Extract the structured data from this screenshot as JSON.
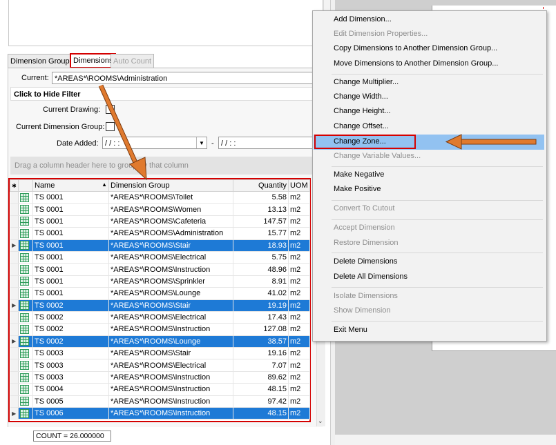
{
  "tabs": [
    {
      "label": "Dimension Groups"
    },
    {
      "label": "Dimensions"
    },
    {
      "label": "Auto Count"
    }
  ],
  "filter": {
    "current_label": "Current:",
    "current_value": "*AREAS*\\ROOMS\\Administration",
    "hide_filter_label": "Click to Hide Filter",
    "current_drawing_label": "Current Drawing:",
    "current_group_label": "Current Dimension Group:",
    "date_added_label": "Date Added:",
    "date_from": "/  /       :  :",
    "date_sep": "-",
    "date_to": "/  /       :  :"
  },
  "group_hint": "Drag a column header here to group by that column",
  "grid": {
    "columns": [
      "Name",
      "Dimension Group",
      "Quantity",
      "UOM"
    ],
    "rows": [
      {
        "name": "TS 0001",
        "group": "*AREAS*\\ROOMS\\Toilet",
        "qty": "5.58",
        "uom": "m2",
        "selected": false
      },
      {
        "name": "TS 0001",
        "group": "*AREAS*\\ROOMS\\Women",
        "qty": "13.13",
        "uom": "m2",
        "selected": false
      },
      {
        "name": "TS 0001",
        "group": "*AREAS*\\ROOMS\\Cafeteria",
        "qty": "147.57",
        "uom": "m2",
        "selected": false
      },
      {
        "name": "TS 0001",
        "group": "*AREAS*\\ROOMS\\Administration",
        "qty": "15.77",
        "uom": "m2",
        "selected": false
      },
      {
        "name": "TS 0001",
        "group": "*AREAS*\\ROOMS\\Stair",
        "qty": "18.93",
        "uom": "m2",
        "selected": true
      },
      {
        "name": "TS 0001",
        "group": "*AREAS*\\ROOMS\\Electrical",
        "qty": "5.75",
        "uom": "m2",
        "selected": false
      },
      {
        "name": "TS 0001",
        "group": "*AREAS*\\ROOMS\\Instruction",
        "qty": "48.96",
        "uom": "m2",
        "selected": false
      },
      {
        "name": "TS 0001",
        "group": "*AREAS*\\ROOMS\\Sprinkler",
        "qty": "8.91",
        "uom": "m2",
        "selected": false
      },
      {
        "name": "TS 0001",
        "group": "*AREAS*\\ROOMS\\Lounge",
        "qty": "41.02",
        "uom": "m2",
        "selected": false
      },
      {
        "name": "TS 0002",
        "group": "*AREAS*\\ROOMS\\Stair",
        "qty": "19.19",
        "uom": "m2",
        "selected": true
      },
      {
        "name": "TS 0002",
        "group": "*AREAS*\\ROOMS\\Electrical",
        "qty": "17.43",
        "uom": "m2",
        "selected": false
      },
      {
        "name": "TS 0002",
        "group": "*AREAS*\\ROOMS\\Instruction",
        "qty": "127.08",
        "uom": "m2",
        "selected": false
      },
      {
        "name": "TS 0002",
        "group": "*AREAS*\\ROOMS\\Lounge",
        "qty": "38.57",
        "uom": "m2",
        "selected": true
      },
      {
        "name": "TS 0003",
        "group": "*AREAS*\\ROOMS\\Stair",
        "qty": "19.16",
        "uom": "m2",
        "selected": false
      },
      {
        "name": "TS 0003",
        "group": "*AREAS*\\ROOMS\\Electrical",
        "qty": "7.07",
        "uom": "m2",
        "selected": false
      },
      {
        "name": "TS 0003",
        "group": "*AREAS*\\ROOMS\\Instruction",
        "qty": "89.62",
        "uom": "m2",
        "selected": false
      },
      {
        "name": "TS 0004",
        "group": "*AREAS*\\ROOMS\\Instruction",
        "qty": "48.15",
        "uom": "m2",
        "selected": false
      },
      {
        "name": "TS 0005",
        "group": "*AREAS*\\ROOMS\\Instruction",
        "qty": "97.42",
        "uom": "m2",
        "selected": false
      },
      {
        "name": "TS 0006",
        "group": "*AREAS*\\ROOMS\\Instruction",
        "qty": "48.15",
        "uom": "m2",
        "selected": true
      }
    ]
  },
  "count_label": "COUNT = 26.000000",
  "context_menu": {
    "items": [
      {
        "label": "Add Dimension...",
        "enabled": true
      },
      {
        "label": "Edit Dimension Properties...",
        "enabled": false
      },
      {
        "label": "Copy Dimensions to Another Dimension Group...",
        "enabled": true
      },
      {
        "label": "Move Dimensions to Another Dimension Group...",
        "enabled": true
      },
      {
        "label": "Change Multiplier...",
        "enabled": true
      },
      {
        "label": "Change Width...",
        "enabled": true
      },
      {
        "label": "Change Height...",
        "enabled": true
      },
      {
        "label": "Change Offset...",
        "enabled": true
      },
      {
        "label": "Change Zone...",
        "enabled": true,
        "highlighted": true
      },
      {
        "label": "Change Variable Values...",
        "enabled": false
      },
      {
        "label": "Make Negative",
        "enabled": true
      },
      {
        "label": "Make Positive",
        "enabled": true
      },
      {
        "label": "Convert To Cutout",
        "enabled": false
      },
      {
        "label": "Accept Dimension",
        "enabled": false
      },
      {
        "label": "Restore Dimension",
        "enabled": false
      },
      {
        "label": "Delete Dimensions",
        "enabled": true
      },
      {
        "label": "Delete All Dimensions",
        "enabled": true
      },
      {
        "label": "Isolate Dimensions",
        "enabled": false
      },
      {
        "label": "Show Dimension",
        "enabled": false
      },
      {
        "label": "Exit Menu",
        "enabled": true
      }
    ]
  },
  "colors": {
    "highlight_box": "#d40000",
    "arrow": "#e07a2e",
    "selection": "#1e7ad6",
    "menu_hover": "#92c2f1"
  }
}
